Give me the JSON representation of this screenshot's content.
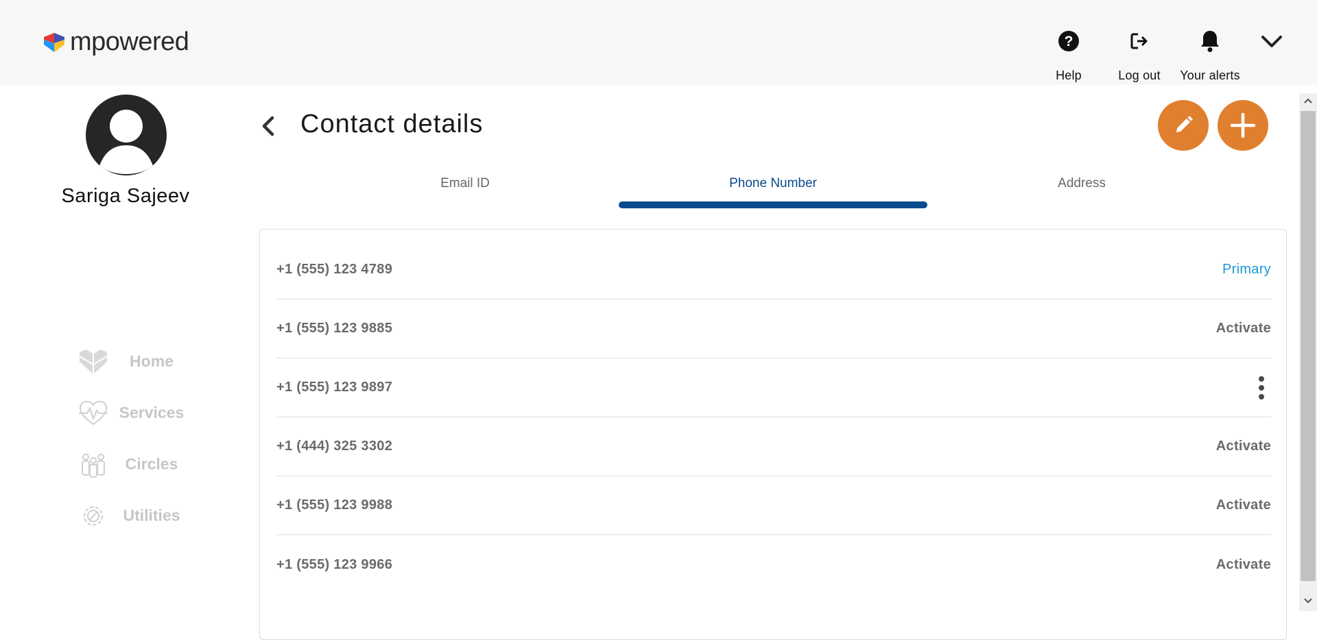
{
  "header": {
    "logo_text": "mpowered",
    "help_label": "Help",
    "logout_label": "Log out",
    "alerts_label": "Your alerts"
  },
  "profile": {
    "name": "Sariga Sajeev"
  },
  "sidebar": {
    "items": [
      {
        "label": "Home",
        "icon": "home-heart-icon"
      },
      {
        "label": "Services",
        "icon": "heart-pulse-icon"
      },
      {
        "label": "Circles",
        "icon": "people-group-icon"
      },
      {
        "label": "Utilities",
        "icon": "gear-wrench-icon"
      }
    ]
  },
  "main": {
    "title": "Contact details",
    "tabs": [
      {
        "label": "Email ID",
        "active": false
      },
      {
        "label": "Phone Number",
        "active": true
      },
      {
        "label": "Address",
        "active": false
      }
    ],
    "phones": [
      {
        "number": "+1 (555) 123 4789",
        "action": "Primary"
      },
      {
        "number": "+1 (555) 123 9885",
        "action": "Activate"
      },
      {
        "number": "+1 (555) 123 9897",
        "action": "more-options"
      },
      {
        "number": "+1 (444) 325 3302",
        "action": "Activate"
      },
      {
        "number": "+1 (555) 123 9988",
        "action": "Activate"
      },
      {
        "number": "+1 (555) 123 9966",
        "action": "Activate"
      }
    ]
  },
  "colors": {
    "accent_orange": "#e07f2e",
    "tab_active": "#064b8c",
    "primary_link": "#1a9ad6",
    "nav_disabled": "#c6c6c6"
  }
}
